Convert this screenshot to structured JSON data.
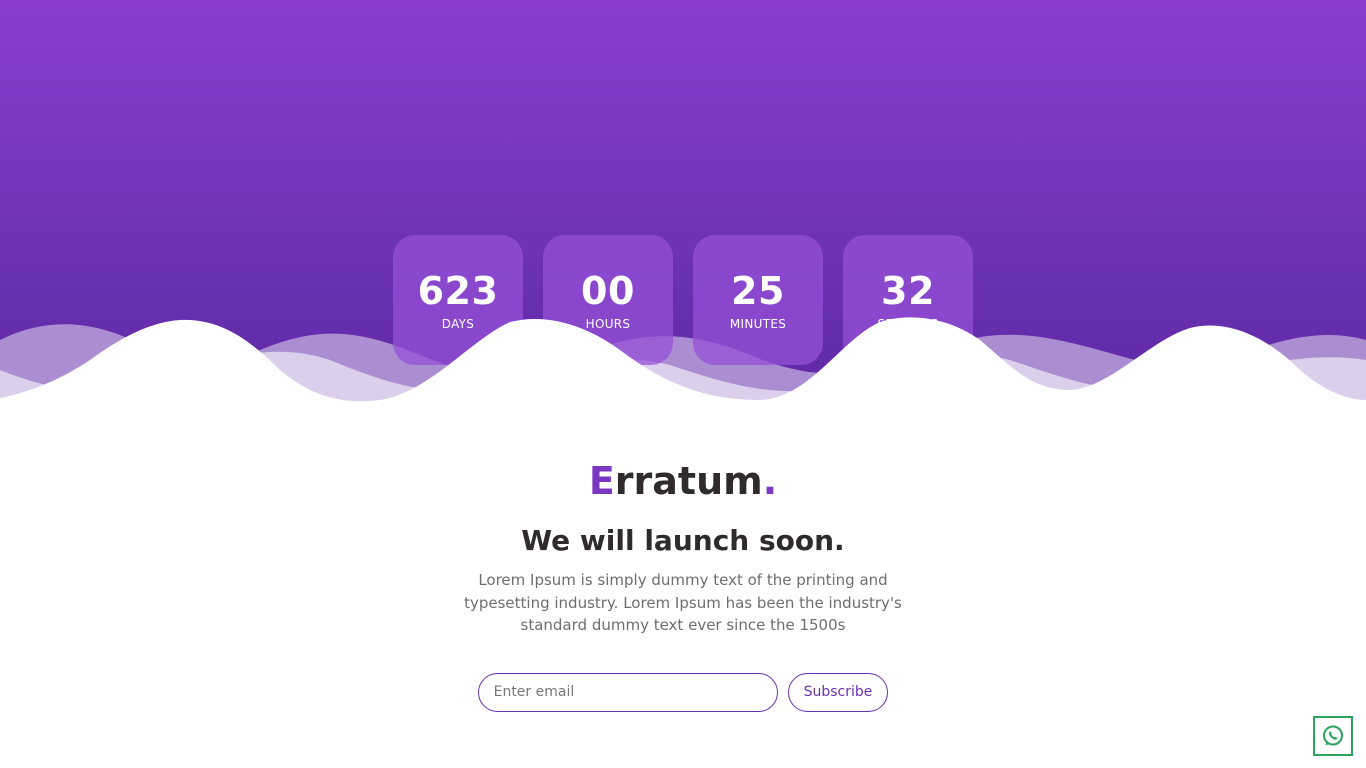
{
  "countdown": [
    {
      "value": "623",
      "label": "DAYS"
    },
    {
      "value": "00",
      "label": "HOURS"
    },
    {
      "value": "25",
      "label": "MINUTES"
    },
    {
      "value": "32",
      "label": "SECONDS"
    }
  ],
  "brand": {
    "first_letter": "E",
    "rest": "rratum",
    "dot": "."
  },
  "headline": "We will launch soon.",
  "description": "Lorem Ipsum is simply dummy text of the printing and typesetting industry. Lorem Ipsum has been the industry's standard dummy text ever since the 1500s",
  "subscribe": {
    "email_placeholder": "Enter email",
    "button_label": "Subscribe"
  },
  "floating": {
    "icon": "whatsapp-icon"
  },
  "colors": {
    "accent": "#7a37c0",
    "whatsapp": "#2aa35b"
  }
}
